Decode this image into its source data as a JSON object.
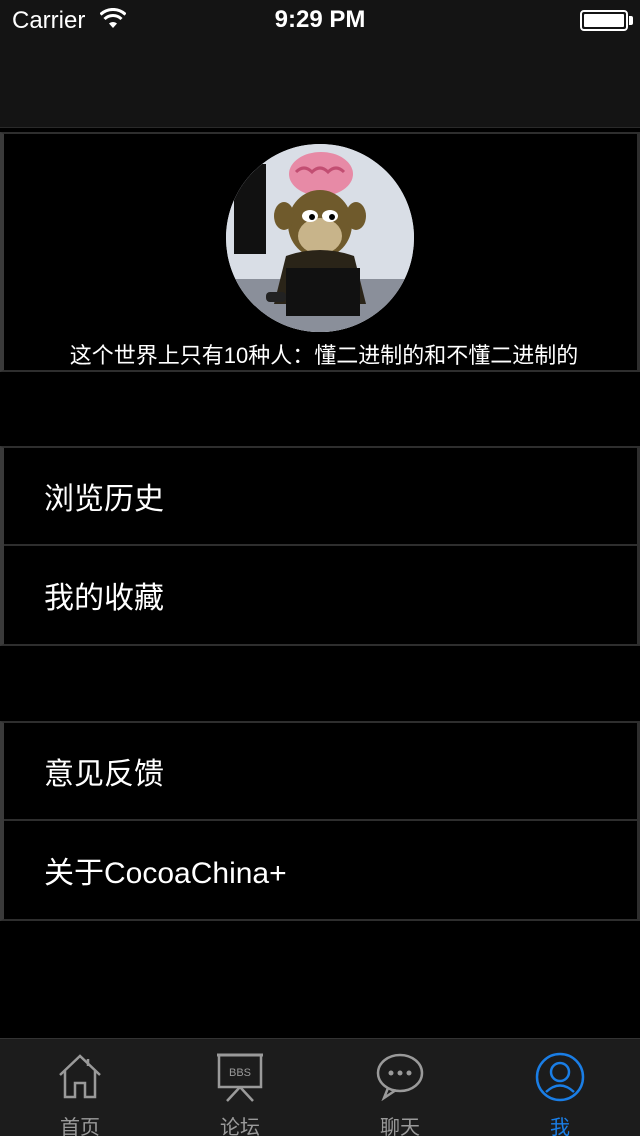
{
  "status_bar": {
    "carrier": "Carrier",
    "time": "9:29 PM",
    "battery_level": 1.0
  },
  "profile": {
    "motto": "这个世界上只有10种人：懂二进制的和不懂二进制的"
  },
  "groups": [
    {
      "items": [
        {
          "label": "浏览历史"
        },
        {
          "label": "我的收藏"
        }
      ]
    },
    {
      "items": [
        {
          "label": "意见反馈"
        },
        {
          "label": "关于CocoaChina+"
        }
      ]
    }
  ],
  "tab_bar": {
    "tabs": [
      {
        "label": "首页",
        "icon": "house-icon",
        "active": false
      },
      {
        "label": "论坛",
        "icon": "bbs-board-icon",
        "active": false
      },
      {
        "label": "聊天",
        "icon": "chat-bubble-icon",
        "active": false
      },
      {
        "label": "我",
        "icon": "user-icon",
        "active": true
      }
    ],
    "bbs_icon_text": "BBS",
    "active_color": "#1a7ee6",
    "inactive_color": "#9a9a9a"
  }
}
